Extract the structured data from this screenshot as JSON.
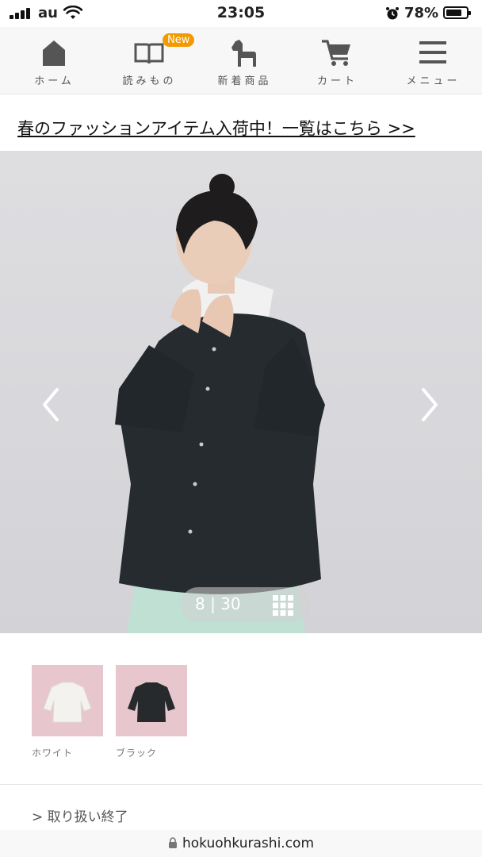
{
  "status_bar": {
    "carrier": "au",
    "time": "23:05",
    "battery_percent": "78%",
    "battery_level": 0.78,
    "icons": [
      "signal-icon",
      "wifi-icon",
      "alarm-icon",
      "battery-icon"
    ]
  },
  "nav": {
    "items": [
      {
        "label": "ホーム",
        "icon": "home-icon"
      },
      {
        "label": "読みもの",
        "icon": "book-icon",
        "badge": "New"
      },
      {
        "label": "新着商品",
        "icon": "horse-icon"
      },
      {
        "label": "カート",
        "icon": "cart-icon"
      },
      {
        "label": "メニュー",
        "icon": "menu-icon"
      }
    ]
  },
  "promo": {
    "text": "春のファッションアイテム入荷中！一覧はこちら >>"
  },
  "gallery": {
    "current": "8",
    "separator": "|",
    "total": "30",
    "prev_icon": "chevron-left-icon",
    "next_icon": "chevron-right-icon",
    "grid_icon": "grid-icon"
  },
  "variants": [
    {
      "label": "ホワイト",
      "color": "#f4f2ee"
    },
    {
      "label": "ブラック",
      "color": "#262a2c"
    }
  ],
  "availability": {
    "text": "> 取り扱い終了"
  },
  "browser": {
    "url": "hokuohkurashi.com",
    "lock_icon": "lock-icon"
  },
  "colors": {
    "accent": "#f39a00",
    "swatch_bg": "#e7c7cd",
    "shirt": "#262b30",
    "skirt": "#bfe0d2"
  }
}
